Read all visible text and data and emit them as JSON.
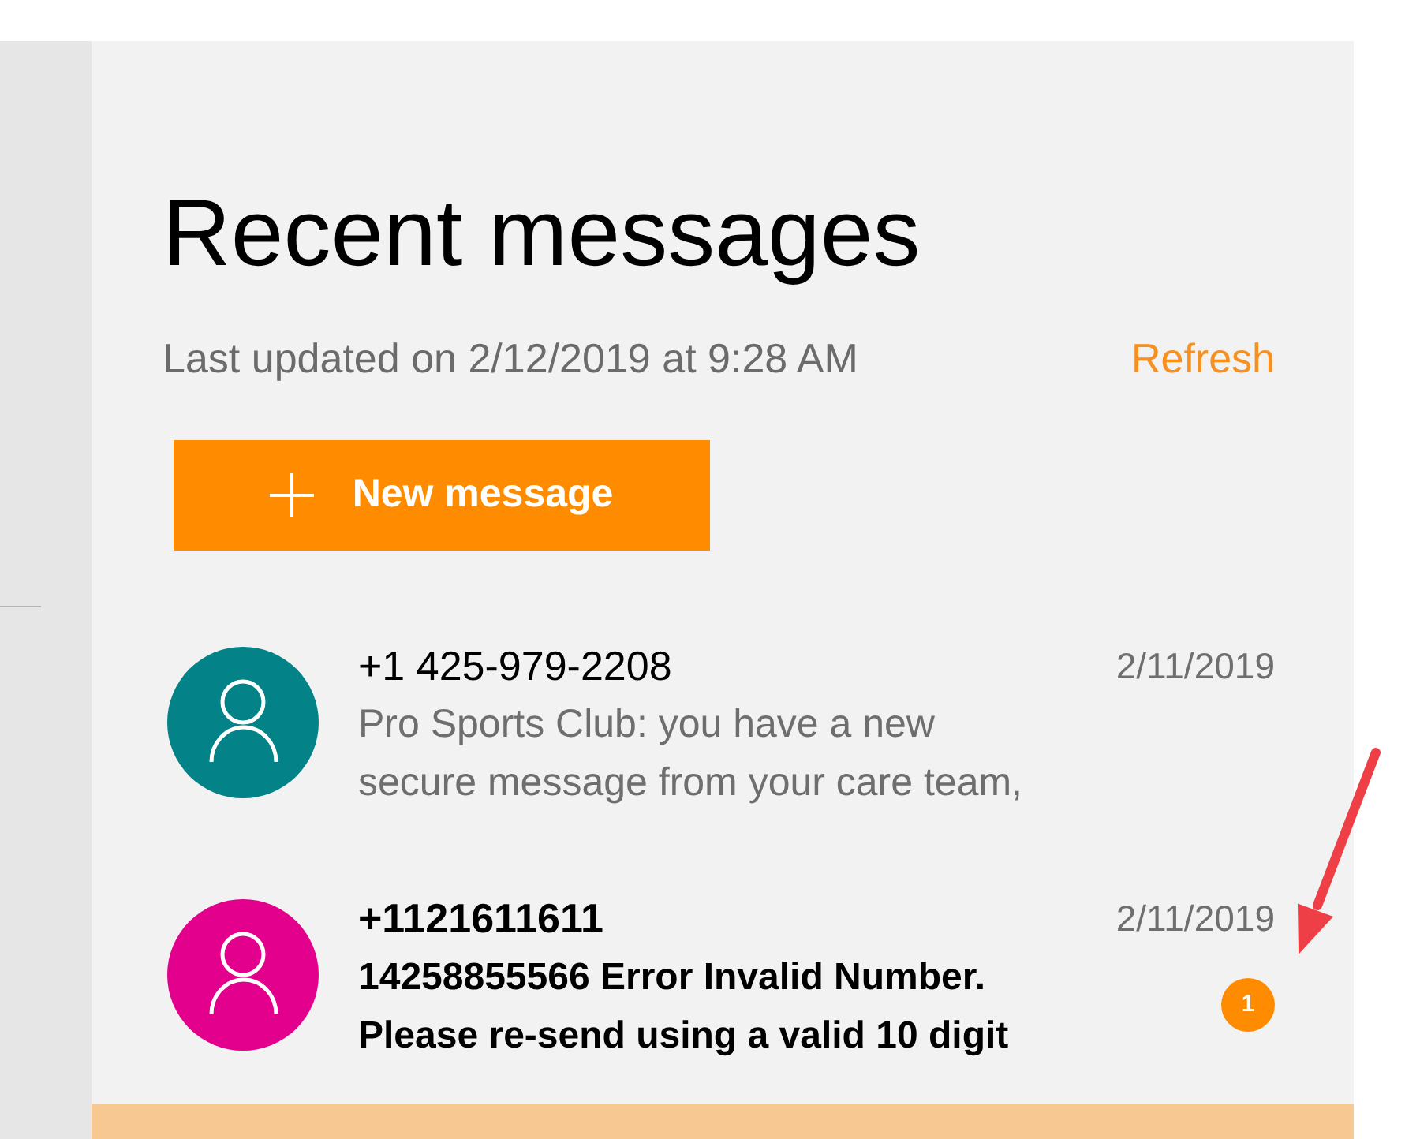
{
  "page": {
    "title": "Recent messages",
    "last_updated": "Last updated on 2/12/2019 at 9:28 AM",
    "refresh_link": "Refresh",
    "new_message_button": "New message"
  },
  "messages": [
    {
      "sender": "+1 425-979-2208",
      "preview_lines": [
        "Pro Sports Club: you have a new",
        "secure message from your care team,"
      ],
      "date": "2/11/2019",
      "color": "#038387",
      "unread": false
    },
    {
      "sender": "+1121611611",
      "preview_lines": [
        "14258855566 Error Invalid Number.",
        "Please re-send using a valid 10 digit"
      ],
      "date": "2/11/2019",
      "color": "#e3008c",
      "unread": true,
      "unread_count": "1"
    }
  ]
}
